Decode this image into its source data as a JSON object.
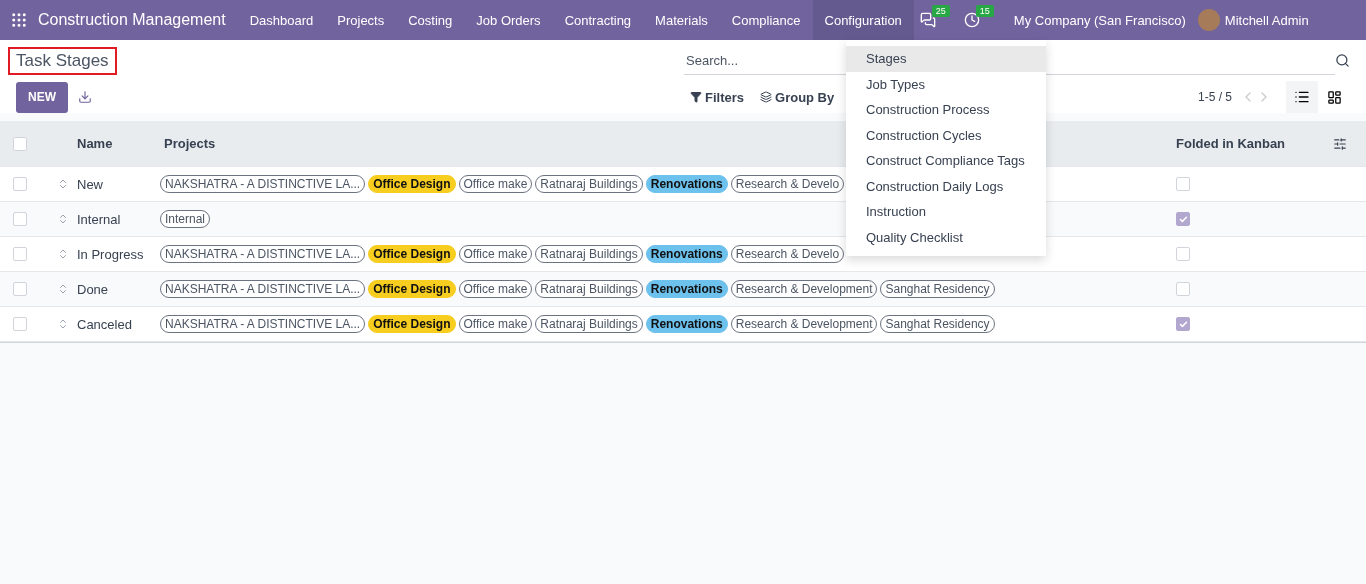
{
  "navbar": {
    "app_title": "Construction Management",
    "menu": [
      {
        "label": "Dashboard",
        "selected": false
      },
      {
        "label": "Projects",
        "selected": false
      },
      {
        "label": "Costing",
        "selected": false
      },
      {
        "label": "Job Orders",
        "selected": false
      },
      {
        "label": "Contracting",
        "selected": false
      },
      {
        "label": "Materials",
        "selected": false
      },
      {
        "label": "Compliance",
        "selected": false
      },
      {
        "label": "Configuration",
        "selected": true
      }
    ],
    "messages_count": "25",
    "activities_count": "15",
    "company": "My Company (San Francisco)",
    "user": "Mitchell Admin"
  },
  "dropdown": [
    {
      "label": "Stages",
      "selected": true
    },
    {
      "label": "Job Types",
      "selected": false
    },
    {
      "label": "Construction Process",
      "selected": false
    },
    {
      "label": "Construction Cycles",
      "selected": false
    },
    {
      "label": "Construct Compliance Tags",
      "selected": false
    },
    {
      "label": "Construction Daily Logs",
      "selected": false
    },
    {
      "label": "Instruction",
      "selected": false
    },
    {
      "label": "Quality Checklist",
      "selected": false
    }
  ],
  "page_title": "Task Stages",
  "search": {
    "placeholder": "Search..."
  },
  "new_button": "NEW",
  "filters": "Filters",
  "group_by": "Group By",
  "pager": "1-5 / 5",
  "table": {
    "select_all_checked": false,
    "columns": [
      "Name",
      "Projects",
      "Folded in Kanban"
    ],
    "rows": [
      {
        "name": "New",
        "checked": false,
        "folded": false,
        "projects": [
          {
            "label": "NAKSHATRA - A DISTINCTIVE LA..."
          },
          {
            "label": "Office Design",
            "color": "#f7cd1f"
          },
          {
            "label": "Office make"
          },
          {
            "label": "Ratnaraj Buildings"
          },
          {
            "label": "Renovations",
            "color": "#6cc1ed"
          },
          {
            "label": "Research & Develo"
          }
        ]
      },
      {
        "name": "Internal",
        "checked": false,
        "folded": true,
        "projects": [
          {
            "label": "Internal"
          }
        ]
      },
      {
        "name": "In Progress",
        "checked": false,
        "folded": false,
        "projects": [
          {
            "label": "NAKSHATRA - A DISTINCTIVE LA..."
          },
          {
            "label": "Office Design",
            "color": "#f7cd1f"
          },
          {
            "label": "Office make"
          },
          {
            "label": "Ratnaraj Buildings"
          },
          {
            "label": "Renovations",
            "color": "#6cc1ed"
          },
          {
            "label": "Research & Develo"
          }
        ]
      },
      {
        "name": "Done",
        "checked": false,
        "folded": false,
        "projects": [
          {
            "label": "NAKSHATRA - A DISTINCTIVE LA..."
          },
          {
            "label": "Office Design",
            "color": "#f7cd1f"
          },
          {
            "label": "Office make"
          },
          {
            "label": "Ratnaraj Buildings"
          },
          {
            "label": "Renovations",
            "color": "#6cc1ed"
          },
          {
            "label": "Research & Development"
          },
          {
            "label": "Sanghat Residency"
          }
        ]
      },
      {
        "name": "Canceled",
        "checked": false,
        "folded": true,
        "projects": [
          {
            "label": "NAKSHATRA - A DISTINCTIVE LA..."
          },
          {
            "label": "Office Design",
            "color": "#f7cd1f"
          },
          {
            "label": "Office make"
          },
          {
            "label": "Ratnaraj Buildings"
          },
          {
            "label": "Renovations",
            "color": "#6cc1ed"
          },
          {
            "label": "Research & Development"
          },
          {
            "label": "Sanghat Residency"
          }
        ]
      }
    ]
  }
}
